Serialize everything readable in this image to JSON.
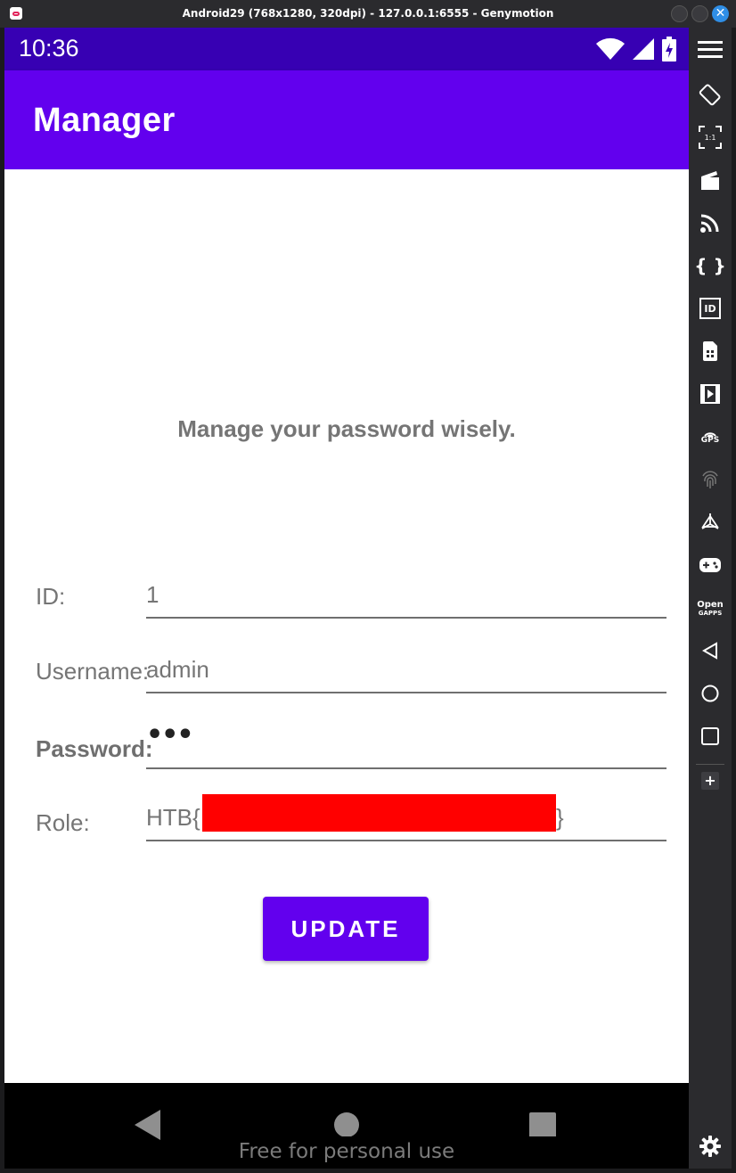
{
  "window": {
    "title": "Android29 (768x1280, 320dpi) - 127.0.0.1:6555 - Genymotion",
    "close_glyph": "✕"
  },
  "statusbar": {
    "time": "10:36"
  },
  "appbar": {
    "title": "Manager"
  },
  "main": {
    "subtitle": "Manage your password wisely.",
    "fields": {
      "id": {
        "label": "ID:",
        "value": "1"
      },
      "username": {
        "label": "Username:",
        "value": "admin"
      },
      "password": {
        "label": "Password:",
        "value": "•••"
      },
      "role": {
        "label": "Role:",
        "value_prefix": "HTB{",
        "value_suffix": "}"
      }
    },
    "update_button": "UPDATE"
  },
  "navbar": {
    "watermark": "Free for personal use"
  },
  "sidebar": {
    "items": [
      {
        "icon": "menu-icon"
      },
      {
        "icon": "rotate-icon"
      },
      {
        "icon": "pixel-perfect-icon",
        "label": "1:1"
      },
      {
        "icon": "capture-icon"
      },
      {
        "icon": "cast-icon"
      },
      {
        "icon": "code-icon",
        "label": "{ }"
      },
      {
        "icon": "device-id-icon",
        "label": "ID"
      },
      {
        "icon": "sim-icon"
      },
      {
        "icon": "media-icon"
      },
      {
        "icon": "gps-icon",
        "label": "GPS"
      },
      {
        "icon": "fingerprint-icon"
      },
      {
        "icon": "motion-icon"
      },
      {
        "icon": "gamepad-icon"
      },
      {
        "icon": "opengapps-icon",
        "label_top": "Open",
        "label_bottom": "GAPPS"
      },
      {
        "icon": "back-icon"
      },
      {
        "icon": "home-icon"
      },
      {
        "icon": "recents-icon"
      },
      {
        "icon": "plus-icon",
        "label": "+"
      },
      {
        "icon": "settings-icon"
      }
    ]
  },
  "colors": {
    "primary": "#6200ee",
    "primary_dark": "#3700b3",
    "redaction": "#ff0000",
    "text_gray": "#757575"
  }
}
